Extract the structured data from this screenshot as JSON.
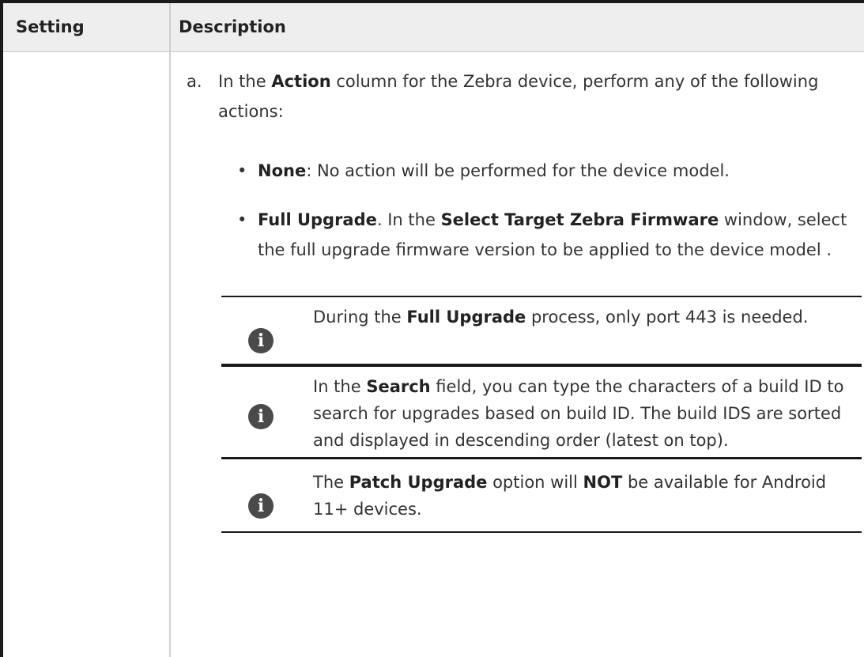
{
  "table": {
    "headers": {
      "setting": "Setting",
      "description": "Description"
    }
  },
  "step_a": {
    "marker": "a.",
    "pre": "In the ",
    "bold": "Action",
    "post": " column for the Zebra device, perform any of the following actions:"
  },
  "bullets": [
    {
      "bold": "None",
      "text": ": No action will be performed for the device model."
    },
    {
      "bold": "Full Upgrade",
      "text1": ". In the ",
      "bold2": "Select Target Zebra Firmware",
      "text2": " window, select the full upgrade firmware version to be applied to the device model ."
    }
  ],
  "notes": [
    {
      "icon": "info-icon",
      "pre": "During the ",
      "bold": "Full Upgrade",
      "post": " process, only port 443 is needed."
    },
    {
      "icon": "info-icon",
      "pre": "In the ",
      "bold": "Search",
      "post": " field, you can type the characters of a build ID to search for upgrades based on build ID. The build IDS are sorted and displayed in descending order (latest on top)."
    },
    {
      "icon": "info-icon",
      "pre": "The ",
      "bold": "Patch Upgrade",
      "mid": " option will ",
      "bold2": "NOT",
      "post": " be available for Android 11+ devices."
    }
  ],
  "colors": {
    "header_bg": "#eeeeee",
    "border": "#1a1a1a",
    "text": "#333333",
    "icon": "#4a4a4a"
  }
}
